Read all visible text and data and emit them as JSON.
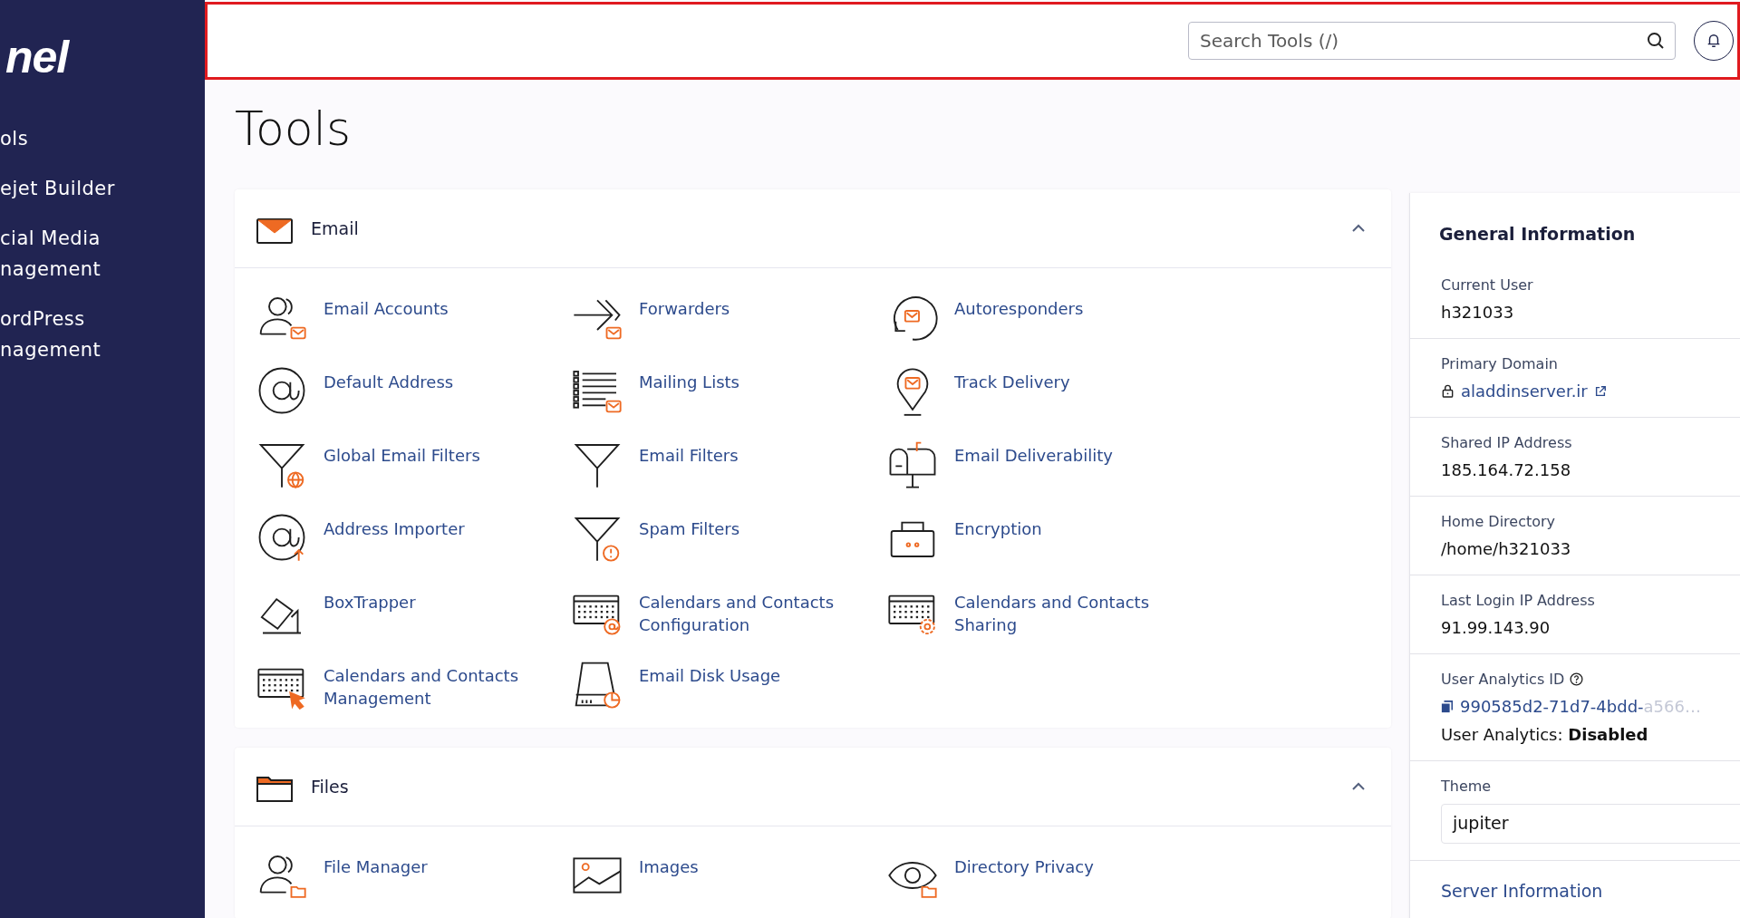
{
  "sidebar": {
    "logo": "nel",
    "items": [
      {
        "label": "ols"
      },
      {
        "label": "ejet Builder"
      },
      {
        "label": "cial Media\nnagement"
      },
      {
        "label": "ordPress\nnagement"
      }
    ]
  },
  "header": {
    "search": {
      "placeholder": "Search Tools (/)"
    }
  },
  "page_title": "Tools",
  "sections": [
    {
      "title": "Email",
      "expanded": true,
      "items": [
        {
          "label": "Email Accounts"
        },
        {
          "label": "Forwarders"
        },
        {
          "label": "Autoresponders"
        },
        {
          "label": "Default Address"
        },
        {
          "label": "Mailing Lists"
        },
        {
          "label": "Track Delivery"
        },
        {
          "label": "Global Email Filters"
        },
        {
          "label": "Email Filters"
        },
        {
          "label": "Email Deliverability"
        },
        {
          "label": "Address Importer"
        },
        {
          "label": "Spam Filters"
        },
        {
          "label": "Encryption"
        },
        {
          "label": "BoxTrapper"
        },
        {
          "label": "Calendars and Contacts Configuration"
        },
        {
          "label": "Calendars and Contacts Sharing"
        },
        {
          "label": "Calendars and Contacts Management"
        },
        {
          "label": "Email Disk Usage"
        }
      ]
    },
    {
      "title": "Files",
      "expanded": true,
      "items": [
        {
          "label": "File Manager"
        },
        {
          "label": "Images"
        },
        {
          "label": "Directory Privacy"
        }
      ]
    }
  ],
  "general_information": {
    "title": "General Information",
    "fields": [
      {
        "kind": "text",
        "label": "Current User",
        "value": "h321033"
      },
      {
        "kind": "domain",
        "label": "Primary Domain",
        "value": "aladdinserver.ir"
      },
      {
        "kind": "text",
        "label": "Shared IP Address",
        "value": "185.164.72.158"
      },
      {
        "kind": "text",
        "label": "Home Directory",
        "value": "/home/h321033"
      },
      {
        "kind": "text",
        "label": "Last Login IP Address",
        "value": "91.99.143.90"
      },
      {
        "kind": "analytics",
        "label": "User Analytics ID",
        "value": "990585d2-71d7-4bdd-",
        "value_faded": "a566…",
        "note": "User Analytics: **Disabled**"
      },
      {
        "kind": "select",
        "label": "Theme",
        "value": "jupiter"
      }
    ],
    "link": "Server Information"
  }
}
